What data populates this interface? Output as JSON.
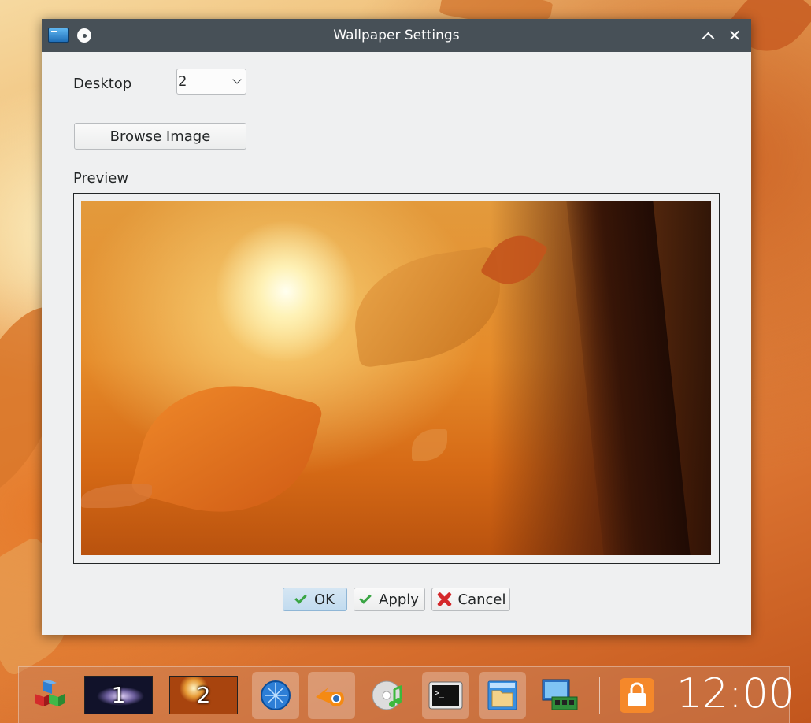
{
  "window": {
    "title": "Wallpaper Settings",
    "desktop_label": "Desktop",
    "desktop_value": "2",
    "browse_label": "Browse Image",
    "preview_label": "Preview",
    "ok_label": "OK",
    "apply_label": "Apply",
    "cancel_label": "Cancel"
  },
  "taskbar": {
    "items": [
      {
        "name": "app-menu-icon"
      },
      {
        "name": "desktop-1",
        "label": "1"
      },
      {
        "name": "desktop-2",
        "label": "2"
      },
      {
        "name": "web-browser-icon"
      },
      {
        "name": "blender-icon"
      },
      {
        "name": "music-player-icon"
      },
      {
        "name": "terminal-icon"
      },
      {
        "name": "file-manager-icon"
      },
      {
        "name": "system-monitor-icon"
      },
      {
        "name": "lock-icon"
      }
    ],
    "clock": "12:00"
  },
  "colors": {
    "titlebar": "#475057",
    "window_bg": "#eff0f1",
    "default_button": "#c1dbef",
    "ok_check": "#3aa544",
    "cancel_x": "#d4282b"
  }
}
